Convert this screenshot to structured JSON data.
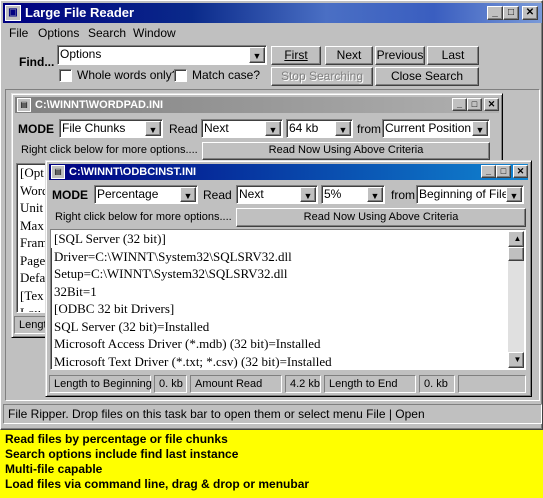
{
  "app": {
    "title": "Large File Reader",
    "icon": "app-icon"
  },
  "menu": [
    "File",
    "Options",
    "Search",
    "Window"
  ],
  "find": {
    "label": "Find...",
    "value": "Options",
    "whole_words_label": "Whole words only?",
    "match_case_label": "Match case?",
    "first": "First",
    "next": "Next",
    "previous": "Previous",
    "last": "Last",
    "stop": "Stop Searching",
    "close": "Close Search"
  },
  "child1": {
    "title": "C:\\WINNT\\WORDPAD.INI",
    "mode_label": "MODE",
    "mode_value": "File Chunks",
    "read_label": "Read",
    "read_value": "Next",
    "size_value": "64 kb",
    "from_label": "from",
    "from_value": "Current Position",
    "hint": "Right click below for more options....",
    "read_now": "Read Now Using Above Criteria",
    "lines": [
      "[Opt",
      "Word",
      "Unit",
      "Max",
      "Fram",
      "Page",
      "Defa",
      "[Tex",
      "Lou"
    ],
    "status": "Lengt"
  },
  "child2": {
    "title": "C:\\WINNT\\ODBCINST.INI",
    "mode_label": "MODE",
    "mode_value": "Percentage",
    "read_label": "Read",
    "read_value": "Next",
    "size_value": "5%",
    "from_label": "from",
    "from_value": "Beginning of File",
    "hint": "Right click below for more options....",
    "read_now": "Read Now Using Above Criteria",
    "lines": [
      "[SQL Server (32 bit)]",
      "Driver=C:\\WINNT\\System32\\SQLSRV32.dll",
      "Setup=C:\\WINNT\\System32\\SQLSRV32.dll",
      "32Bit=1",
      "[ODBC 32 bit Drivers]",
      "SQL Server (32 bit)=Installed",
      "Microsoft Access Driver (*.mdb) (32 bit)=Installed",
      "Microsoft Text Driver (*.txt; *.csv) (32 bit)=Installed"
    ],
    "status": {
      "length_to_beginning_label": "Length to Beginning",
      "length_to_beginning_value": "0. kb",
      "amount_read_label": "Amount Read",
      "amount_read_value": "4.2 kb",
      "length_to_end_label": "Length to End",
      "length_to_end_value": "0. kb"
    }
  },
  "statusbar": "File Ripper.  Drop files on this task bar to open them or select menu File | Open",
  "footer": [
    "Read files by percentage or file chunks",
    "Search options include find last instance",
    "Multi-file capable",
    "Load files via command line,  drag & drop or menubar"
  ],
  "colors": {
    "background": "#ffff00",
    "title_active": "#000080",
    "face": "#c0c0c0"
  }
}
